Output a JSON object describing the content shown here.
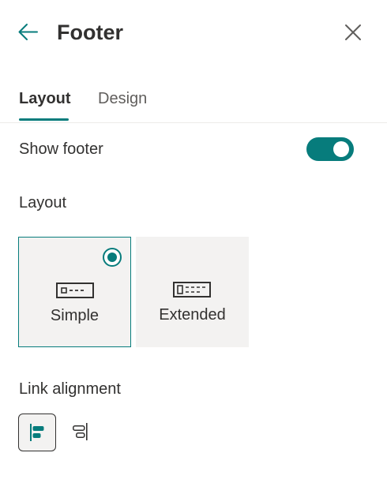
{
  "header": {
    "title": "Footer"
  },
  "tabs": [
    {
      "label": "Layout",
      "active": true
    },
    {
      "label": "Design",
      "active": false
    }
  ],
  "show_footer": {
    "label": "Show footer",
    "enabled": true
  },
  "layout": {
    "label": "Layout",
    "options": [
      {
        "label": "Simple",
        "selected": true
      },
      {
        "label": "Extended",
        "selected": false
      }
    ]
  },
  "link_alignment": {
    "label": "Link alignment",
    "options": [
      {
        "name": "align-left",
        "selected": true
      },
      {
        "name": "align-right",
        "selected": false
      }
    ]
  },
  "colors": {
    "accent": "#077c7c",
    "text": "#323130",
    "card_bg": "#f3f2f1"
  },
  "icons": [
    "back-arrow-icon",
    "close-icon",
    "simple-footer-icon",
    "extended-footer-icon",
    "align-left-icon",
    "align-right-icon"
  ]
}
